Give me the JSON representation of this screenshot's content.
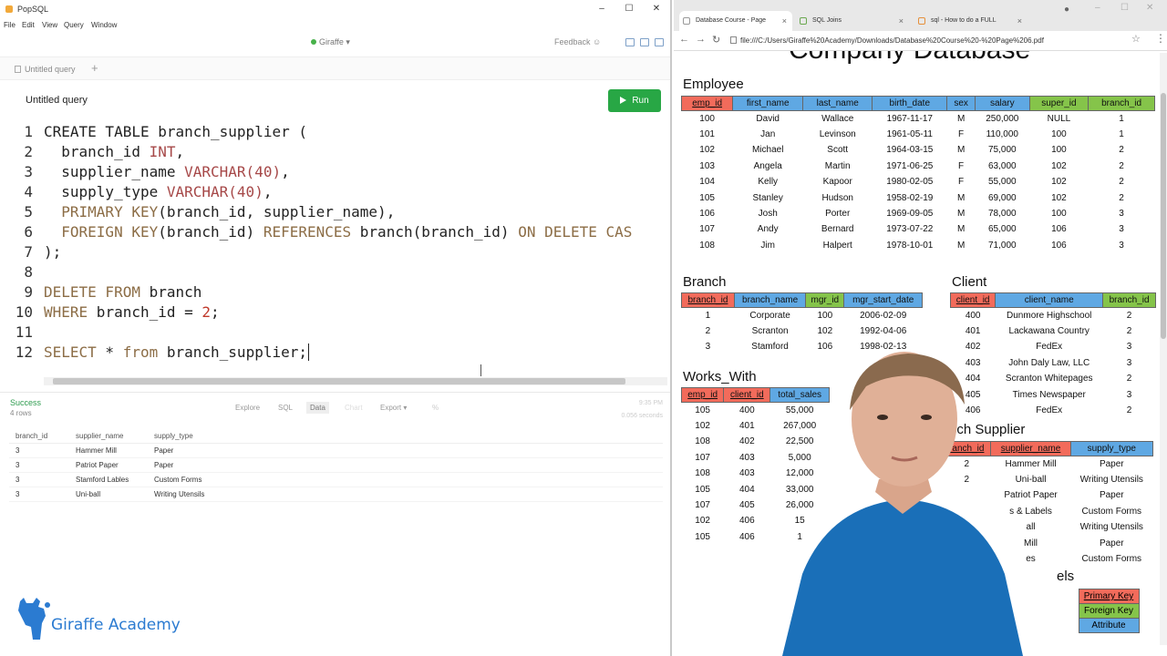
{
  "popsql": {
    "app_title": "PopSQL",
    "menu": [
      "File",
      "Edit",
      "View",
      "Query",
      "Window"
    ],
    "connection": "Giraffe",
    "feedback": "Feedback",
    "tab_label": "Untitled query",
    "tab_add": "+",
    "query_title": "Untitled query",
    "run_label": "Run",
    "code_lines": [
      {
        "n": "1",
        "segs": [
          [
            "pl",
            "CREATE TABLE branch_supplier ("
          ]
        ]
      },
      {
        "n": "2",
        "segs": [
          [
            "pl",
            "  branch_id "
          ],
          [
            "kw",
            "INT"
          ],
          [
            "pl",
            ","
          ]
        ]
      },
      {
        "n": "3",
        "segs": [
          [
            "pl",
            "  supplier_name "
          ],
          [
            "kw",
            "VARCHAR(40)"
          ],
          [
            "pl",
            ","
          ]
        ]
      },
      {
        "n": "4",
        "segs": [
          [
            "pl",
            "  supply_type "
          ],
          [
            "kw",
            "VARCHAR(40)"
          ],
          [
            "pl",
            ","
          ]
        ]
      },
      {
        "n": "5",
        "segs": [
          [
            "cm",
            "  PRIMARY KEY"
          ],
          [
            "pl",
            "(branch_id, supplier_name),"
          ]
        ]
      },
      {
        "n": "6",
        "segs": [
          [
            "cm",
            "  FOREIGN KEY"
          ],
          [
            "pl",
            "(branch_id) "
          ],
          [
            "cm",
            "REFERENCES"
          ],
          [
            "pl",
            " branch(branch_id) "
          ],
          [
            "cm",
            "ON DELETE CAS"
          ]
        ]
      },
      {
        "n": "7",
        "segs": [
          [
            "pl",
            ");"
          ]
        ]
      },
      {
        "n": "8",
        "segs": []
      },
      {
        "n": "9",
        "segs": [
          [
            "cm",
            "DELETE FROM"
          ],
          [
            "pl",
            " branch"
          ]
        ]
      },
      {
        "n": "10",
        "segs": [
          [
            "cm",
            "WHERE"
          ],
          [
            "pl",
            " branch_id = "
          ],
          [
            "str",
            "2"
          ],
          [
            "pl",
            ";"
          ]
        ]
      },
      {
        "n": "11",
        "segs": []
      },
      {
        "n": "12",
        "segs": [
          [
            "cm",
            "SELECT"
          ],
          [
            "pl",
            " * "
          ],
          [
            "cm",
            "from"
          ],
          [
            "pl",
            " branch_supplier;"
          ]
        ]
      }
    ],
    "results": {
      "status": "Success",
      "row_count": "4 rows",
      "tabs": [
        "Explore",
        "SQL",
        "Data",
        "Chart",
        "Export ▾",
        "%"
      ],
      "time": "9:35 PM",
      "duration": "0.056 seconds",
      "columns": [
        "branch_id",
        "supplier_name",
        "supply_type"
      ],
      "rows": [
        [
          "3",
          "Hammer Mill",
          "Paper"
        ],
        [
          "3",
          "Patriot Paper",
          "Paper"
        ],
        [
          "3",
          "Stamford Lables",
          "Custom Forms"
        ],
        [
          "3",
          "Uni-ball",
          "Writing Utensils"
        ]
      ]
    },
    "logo_text": "Giraffe Academy"
  },
  "browser": {
    "tabs": [
      {
        "label": "Database Course - Page",
        "close": "×"
      },
      {
        "label": "SQL Joins",
        "close": "×"
      },
      {
        "label": "sql - How to do a FULL",
        "close": "×"
      }
    ],
    "url": "file:///C:/Users/Giraffe%20Academy/Downloads/Database%20Course%20-%20Page%206.pdf",
    "pdf": {
      "title": "Company Database",
      "employee": {
        "heading": "Employee",
        "columns": [
          "emp_id",
          "first_name",
          "last_name",
          "birth_date",
          "sex",
          "salary",
          "super_id",
          "branch_id"
        ],
        "rows": [
          [
            "100",
            "David",
            "Wallace",
            "1967-11-17",
            "M",
            "250,000",
            "NULL",
            "1"
          ],
          [
            "101",
            "Jan",
            "Levinson",
            "1961-05-11",
            "F",
            "110,000",
            "100",
            "1"
          ],
          [
            "102",
            "Michael",
            "Scott",
            "1964-03-15",
            "M",
            "75,000",
            "100",
            "2"
          ],
          [
            "103",
            "Angela",
            "Martin",
            "1971-06-25",
            "F",
            "63,000",
            "102",
            "2"
          ],
          [
            "104",
            "Kelly",
            "Kapoor",
            "1980-02-05",
            "F",
            "55,000",
            "102",
            "2"
          ],
          [
            "105",
            "Stanley",
            "Hudson",
            "1958-02-19",
            "M",
            "69,000",
            "102",
            "2"
          ],
          [
            "106",
            "Josh",
            "Porter",
            "1969-09-05",
            "M",
            "78,000",
            "100",
            "3"
          ],
          [
            "107",
            "Andy",
            "Bernard",
            "1973-07-22",
            "M",
            "65,000",
            "106",
            "3"
          ],
          [
            "108",
            "Jim",
            "Halpert",
            "1978-10-01",
            "M",
            "71,000",
            "106",
            "3"
          ]
        ]
      },
      "branch": {
        "heading": "Branch",
        "columns": [
          "branch_id",
          "branch_name",
          "mgr_id",
          "mgr_start_date"
        ],
        "rows": [
          [
            "1",
            "Corporate",
            "100",
            "2006-02-09"
          ],
          [
            "2",
            "Scranton",
            "102",
            "1992-04-06"
          ],
          [
            "3",
            "Stamford",
            "106",
            "1998-02-13"
          ]
        ]
      },
      "client": {
        "heading": "Client",
        "columns": [
          "client_id",
          "client_name",
          "branch_id"
        ],
        "rows": [
          [
            "400",
            "Dunmore Highschool",
            "2"
          ],
          [
            "401",
            "Lackawana Country",
            "2"
          ],
          [
            "402",
            "FedEx",
            "3"
          ],
          [
            "403",
            "John Daly Law, LLC",
            "3"
          ],
          [
            "404",
            "Scranton Whitepages",
            "2"
          ],
          [
            "405",
            "Times Newspaper",
            "3"
          ],
          [
            "406",
            "FedEx",
            "2"
          ]
        ]
      },
      "works_with": {
        "heading": "Works_With",
        "columns": [
          "emp_id",
          "client_id",
          "total_sales"
        ],
        "rows": [
          [
            "105",
            "400",
            "55,000"
          ],
          [
            "102",
            "401",
            "267,000"
          ],
          [
            "108",
            "402",
            "22,500"
          ],
          [
            "107",
            "403",
            "5,000"
          ],
          [
            "108",
            "403",
            "12,000"
          ],
          [
            "105",
            "404",
            "33,000"
          ],
          [
            "107",
            "405",
            "26,000"
          ],
          [
            "102",
            "406",
            "15"
          ],
          [
            "105",
            "406",
            "1"
          ]
        ]
      },
      "branch_supplier": {
        "heading": "nch Supplier",
        "columns": [
          "ranch_id",
          "supplier_name",
          "supply_type"
        ],
        "rows": [
          [
            "2",
            "Hammer Mill",
            "Paper"
          ],
          [
            "2",
            "Uni-ball",
            "Writing Utensils"
          ],
          [
            "",
            "Patriot Paper",
            "Paper"
          ],
          [
            "",
            "s & Labels",
            "Custom Forms"
          ],
          [
            "",
            "all",
            "Writing Utensils"
          ],
          [
            "",
            "Mill",
            "Paper"
          ],
          [
            "",
            "es",
            "Custom Forms"
          ]
        ]
      },
      "legend": {
        "heading": "els",
        "items": [
          "Primary Key",
          "Foreign Key",
          "Attribute"
        ]
      }
    }
  },
  "colors": {
    "primary_key": "#f26b5b",
    "foreign_key": "#85c44a",
    "attribute": "#5fa8e3",
    "run_button": "#28a745",
    "success": "#2e9c4f",
    "logo": "#2b7bd1",
    "shirt": "#1a6fb8"
  }
}
